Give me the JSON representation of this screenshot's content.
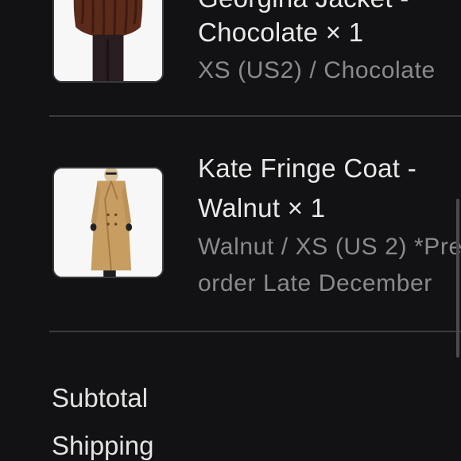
{
  "items": [
    {
      "name_line1": "Georgina Jacket -",
      "name_line2": "Chocolate × 1",
      "variant_line1": "XS (US2) / Chocolate",
      "variant_line2": ""
    },
    {
      "name_line1": "Kate Fringe Coat -",
      "name_line2": "Walnut × 1",
      "variant_line1": "Walnut / XS (US 2) *Pre",
      "variant_line2": "order Late December"
    }
  ],
  "summary": {
    "subtotal_label": "Subtotal",
    "shipping_label": "Shipping"
  },
  "colors": {
    "background": "#121214",
    "divider": "#3a3a3d",
    "muted_text": "#8a8a8e"
  }
}
